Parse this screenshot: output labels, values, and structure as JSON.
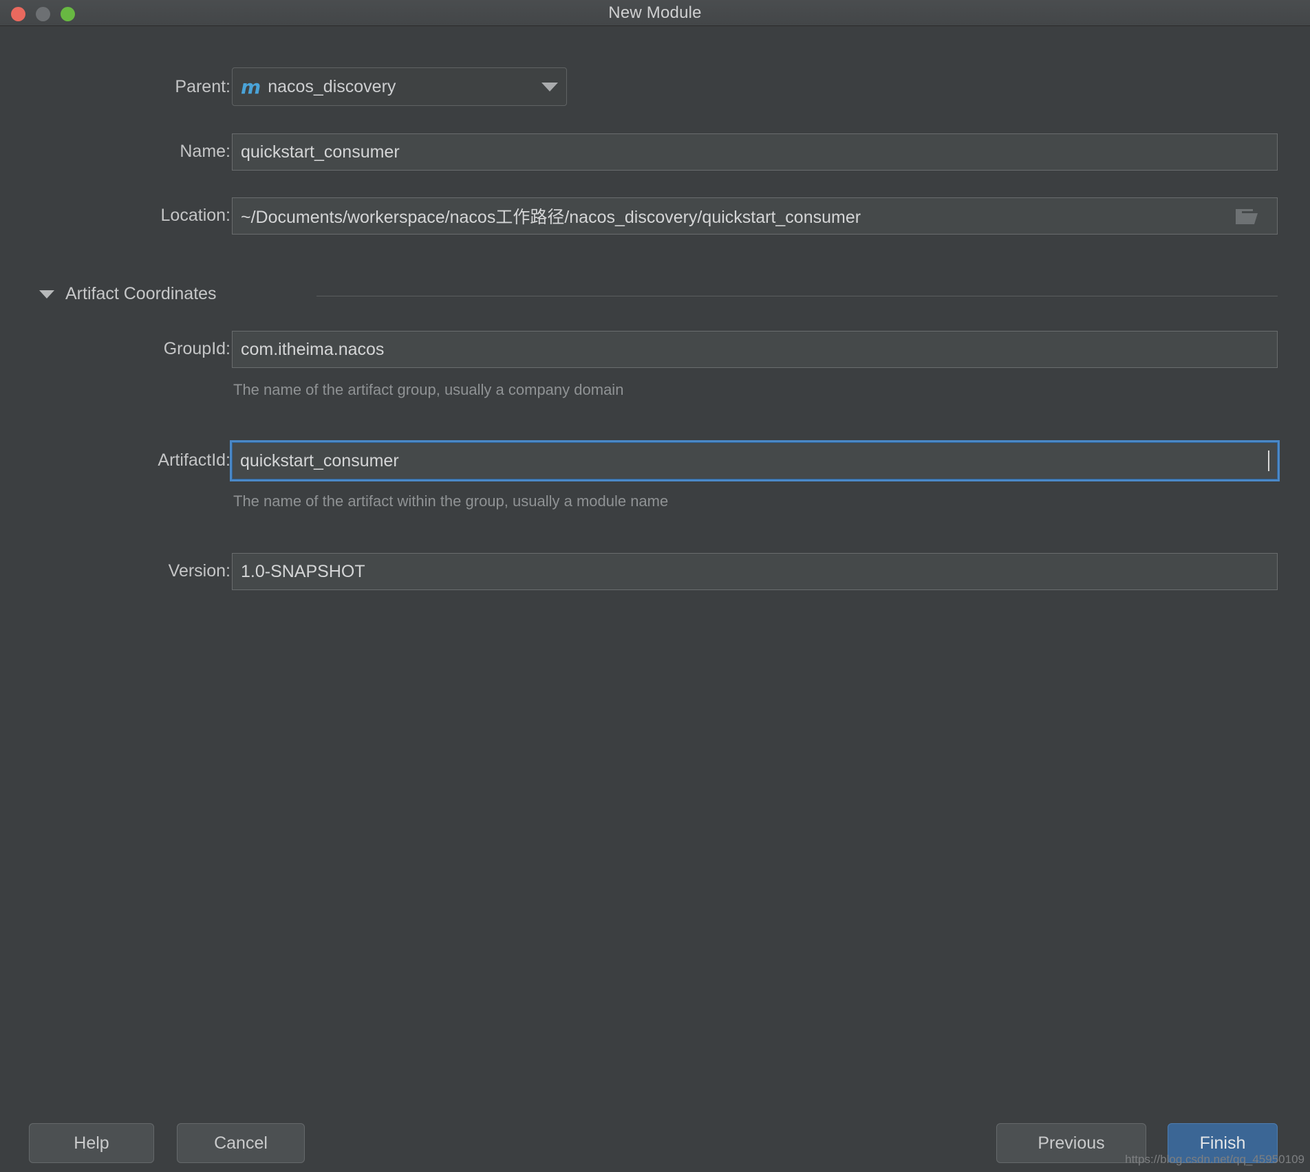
{
  "window": {
    "title": "New Module",
    "controls": [
      {
        "name": "close",
        "color": "#e9695e"
      },
      {
        "name": "minimize",
        "color": "#6d7073"
      },
      {
        "name": "zoom",
        "color": "#68b842"
      }
    ]
  },
  "form": {
    "parent": {
      "label": "Parent:",
      "icon": "m",
      "value": "nacos_discovery"
    },
    "name": {
      "label": "Name:",
      "value": "quickstart_consumer"
    },
    "location": {
      "label": "Location:",
      "value": "~/Documents/workerspace/nacos工作路径/nacos_discovery/quickstart_consumer",
      "browse_icon": "folder-open-icon"
    },
    "section": {
      "title": "Artifact Coordinates",
      "expanded": true
    },
    "group_id": {
      "label": "GroupId:",
      "value": "com.itheima.nacos",
      "hint": "The name of the artifact group, usually a company domain"
    },
    "artifact_id": {
      "label": "ArtifactId:",
      "value": "quickstart_consumer",
      "hint": "The name of the artifact within the group, usually a module name",
      "focused": true
    },
    "version": {
      "label": "Version:",
      "value": "1.0-SNAPSHOT"
    }
  },
  "buttons": {
    "help": "Help",
    "cancel": "Cancel",
    "previous": "Previous",
    "finish": "Finish"
  },
  "watermark": "https://blog.csdn.net/qq_45950109",
  "colors": {
    "dialog_bg": "#3c3f41",
    "field_bg": "#45494a",
    "focus_blue": "#4a88c7",
    "primary_button": "#3b6695",
    "maven_icon_blue": "#4aa3d8"
  }
}
